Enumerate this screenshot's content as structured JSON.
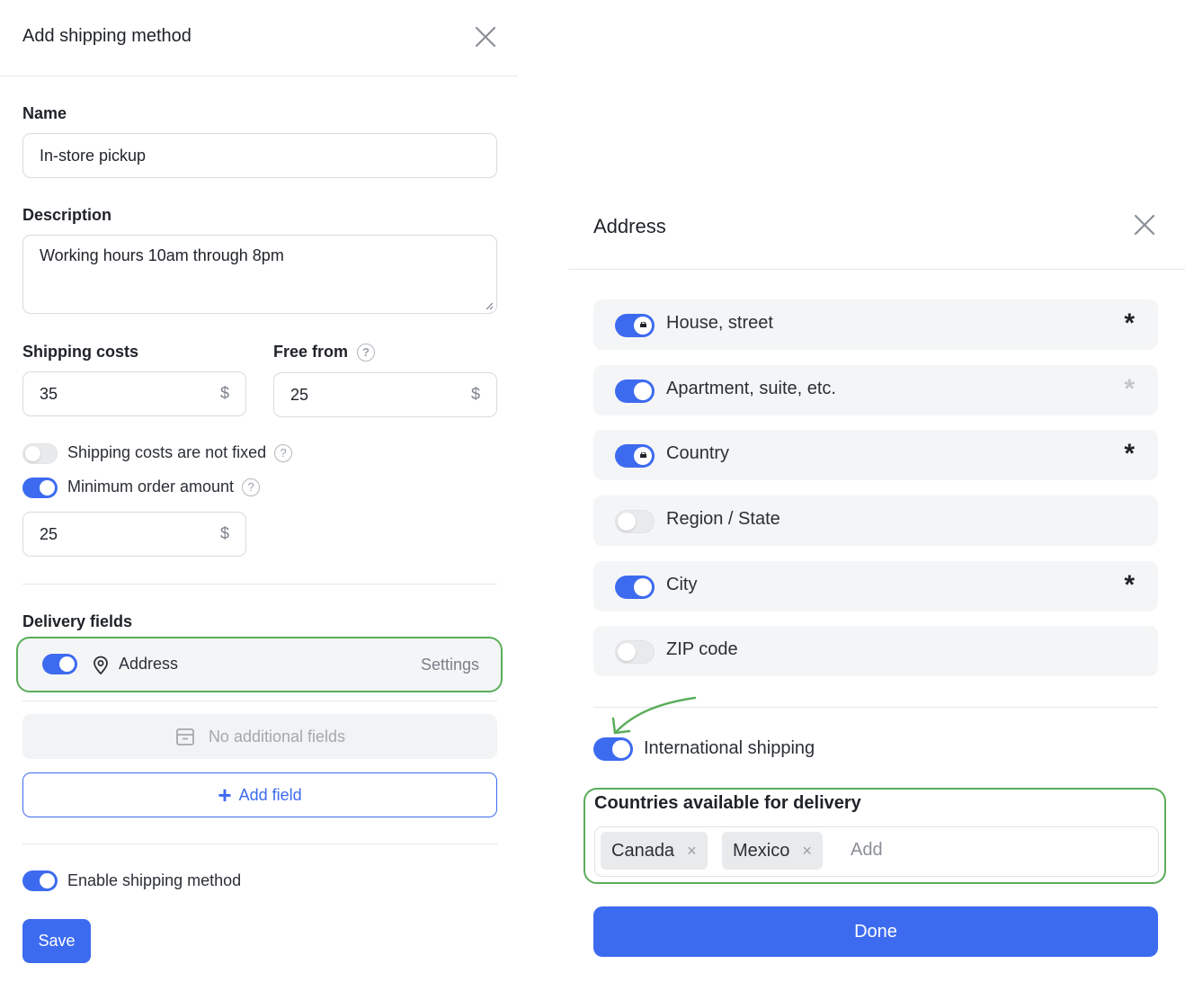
{
  "colors": {
    "accent": "#3d6bf0",
    "highlight": "#5aad5a",
    "required": "#1f2329",
    "optional": "#c4c7cc"
  },
  "left": {
    "title": "Add shipping method",
    "name_label": "Name",
    "name_value": "In-store pickup",
    "description_label": "Description",
    "description_value": "Working hours 10am through 8pm",
    "shipping_costs_label": "Shipping costs",
    "shipping_costs_value": "35",
    "free_from_label": "Free from",
    "free_from_value": "25",
    "currency": "$",
    "help": "?",
    "not_fixed_label": "Shipping costs are not fixed",
    "not_fixed_on": false,
    "min_order_label": "Minimum order amount",
    "min_order_on": true,
    "min_order_value": "25",
    "delivery_fields_label": "Delivery fields",
    "address_label": "Address",
    "address_on": true,
    "settings_label": "Settings",
    "no_fields_label": "No additional fields",
    "add_field_label": "Add field",
    "add_field_plus": "+",
    "enable_label": "Enable shipping method",
    "enable_on": true,
    "save_label": "Save"
  },
  "right": {
    "title": "Address",
    "fields": [
      {
        "label": "House, street",
        "enabled": true,
        "locked": true,
        "required": true,
        "asterisk": "*"
      },
      {
        "label": "Apartment, suite, etc.",
        "enabled": true,
        "locked": false,
        "required": false,
        "asterisk": "*"
      },
      {
        "label": "Country",
        "enabled": true,
        "locked": true,
        "required": true,
        "asterisk": "*"
      },
      {
        "label": "Region / State",
        "enabled": false,
        "locked": false,
        "required": false,
        "asterisk": ""
      },
      {
        "label": "City",
        "enabled": true,
        "locked": false,
        "required": true,
        "asterisk": "*"
      },
      {
        "label": "ZIP code",
        "enabled": false,
        "locked": false,
        "required": false,
        "asterisk": ""
      }
    ],
    "international_label": "International shipping",
    "international_on": true,
    "countries_label": "Countries available for delivery",
    "countries": [
      {
        "name": "Canada",
        "remove": "×"
      },
      {
        "name": "Mexico",
        "remove": "×"
      }
    ],
    "add_placeholder": "Add",
    "done_label": "Done"
  }
}
